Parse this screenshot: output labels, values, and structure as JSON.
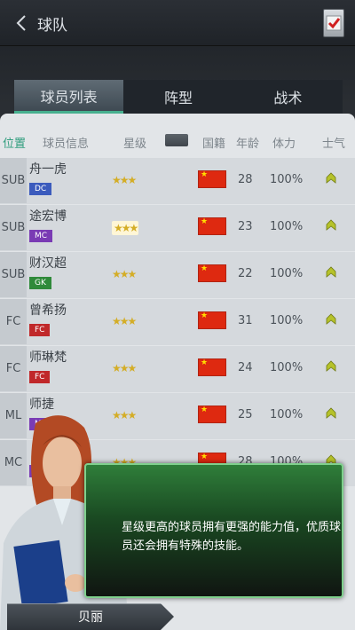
{
  "header": {
    "title": "球队"
  },
  "tabs": [
    {
      "label": "球员列表",
      "active": true
    },
    {
      "label": "阵型",
      "active": false
    },
    {
      "label": "战术",
      "active": false
    }
  ],
  "table": {
    "columns": [
      "位置",
      "球员信息",
      "星级",
      "国籍",
      "年龄",
      "体力",
      "士气"
    ],
    "rows": [
      {
        "position": "SUB",
        "name": "舟一虎",
        "role": "DC",
        "role_color": "#3b5bbd",
        "age": "28",
        "stamina": "100%",
        "stars": "★★★",
        "highlight": false
      },
      {
        "position": "SUB",
        "name": "途宏博",
        "role": "MC",
        "role_color": "#7a3bb4",
        "age": "23",
        "stamina": "100%",
        "stars": "★★★",
        "highlight": true
      },
      {
        "position": "SUB",
        "name": "财汉超",
        "role": "GK",
        "role_color": "#2f8a3a",
        "age": "22",
        "stamina": "100%",
        "stars": "★★★",
        "highlight": false
      },
      {
        "position": "FC",
        "name": "曾希扬",
        "role": "FC",
        "role_color": "#c0282a",
        "age": "31",
        "stamina": "100%",
        "stars": "★★★",
        "highlight": false
      },
      {
        "position": "FC",
        "name": "师琳梵",
        "role": "FC",
        "role_color": "#c0282a",
        "age": "24",
        "stamina": "100%",
        "stars": "★★★",
        "highlight": false
      },
      {
        "position": "ML",
        "name": "师捷",
        "role": "ML",
        "role_color": "#7a3bb4",
        "age": "25",
        "stamina": "100%",
        "stars": "★★★",
        "highlight": false
      },
      {
        "position": "MC",
        "name": "",
        "role": "MC",
        "role_color": "#7a3bb4",
        "age": "28",
        "stamina": "100%",
        "stars": "★★★",
        "highlight": false
      }
    ]
  },
  "dialog": {
    "text": "星级更高的球员拥有更强的能力值，优质球员还会拥有特殊的技能。"
  },
  "coach": {
    "name": "贝丽"
  }
}
